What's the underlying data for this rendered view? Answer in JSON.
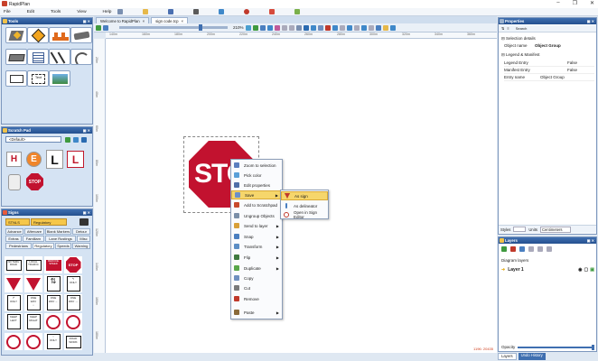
{
  "window": {
    "title": "RapidPlan",
    "minimize": "–",
    "restore": "❐",
    "close": "✕"
  },
  "menu": [
    "File",
    "Edit",
    "Tools",
    "View",
    "Help"
  ],
  "tools_panel": {
    "title": "Tools"
  },
  "scratchpad": {
    "title": "Scratch Pad",
    "selector": "<Default>"
  },
  "signs_panel": {
    "title": "Signs",
    "dropdown_left": "STNLS",
    "dropdown_right": "Regulatory",
    "categories_row1": [
      "Advance",
      "Aftercare",
      "Blank Markers",
      "Detour"
    ],
    "categories_row2": [
      "Extras",
      "Familiarn",
      "Lane Rustings",
      "Misc"
    ],
    "categories_row3": [
      "Pedestrians",
      "Regulatory",
      "Speeds",
      "Warning"
    ]
  },
  "tabs": [
    {
      "label": "Welcome to RapidPlan",
      "close": "×",
      "active": false
    },
    {
      "label": "sign code.tcp",
      "close": "×",
      "active": true
    }
  ],
  "zoom": "210%",
  "ruler_top": [
    "140m",
    "160m",
    "180m",
    "200m",
    "220m",
    "240m",
    "260m",
    "280m",
    "300m",
    "320m",
    "340m",
    "360m"
  ],
  "ruler_left": [
    "20m",
    "40m",
    "60m",
    "80m",
    "100m",
    "120m",
    "140m",
    "160m",
    "180m"
  ],
  "stop_sign_text": "STO",
  "context_menu": [
    {
      "label": "Zoom to selection",
      "arrow": "",
      "highlighted": false,
      "color": "#5b7fbf"
    },
    {
      "label": "Pick color",
      "arrow": "",
      "highlighted": false,
      "color": "#5aa0d8"
    },
    {
      "label": "Edit properties",
      "arrow": "",
      "highlighted": false,
      "color": "#4f6fa8"
    },
    {
      "label": "Save",
      "arrow": "▶",
      "highlighted": true,
      "color": "#6b8fc9"
    },
    {
      "label": "Add to Scratchpad",
      "arrow": "",
      "highlighted": false,
      "color": "#c94a2b"
    },
    {
      "label": "Ungroup Objects",
      "arrow": "",
      "highlighted": false,
      "color": "#7b8fa8"
    },
    {
      "label": "Send to layer",
      "arrow": "▶",
      "highlighted": false,
      "color": "#d8a038"
    },
    {
      "label": "Snap",
      "arrow": "▶",
      "highlighted": false,
      "color": "#4a7fc0"
    },
    {
      "label": "Transform",
      "arrow": "▶",
      "highlighted": false,
      "color": "#5c8ec5"
    },
    {
      "label": "Flip",
      "arrow": "▶",
      "highlighted": false,
      "color": "#3f7a3f"
    },
    {
      "label": "Duplicate",
      "arrow": "▶",
      "highlighted": false,
      "color": "#59a64a"
    },
    {
      "label": "Copy",
      "arrow": "",
      "highlighted": false,
      "color": "#6f8fbf"
    },
    {
      "label": "Cut",
      "arrow": "",
      "highlighted": false,
      "color": "#7a7a7a"
    },
    {
      "label": "Remove",
      "arrow": "",
      "highlighted": false,
      "color": "#c0392b"
    },
    {
      "label": "Paste",
      "arrow": "▶",
      "highlighted": false,
      "color": "#8a6a3a"
    }
  ],
  "submenu": [
    {
      "label": "As sign",
      "highlighted": true
    },
    {
      "label": "As delineator",
      "highlighted": false
    },
    {
      "label": "Open in Sign Editor",
      "highlighted": false
    }
  ],
  "properties": {
    "title": "Properties",
    "search": "Search",
    "section1": "Selection details",
    "object_name_label": "Object name",
    "object_name_value": "Object Group",
    "section2": "Legend & Manifest",
    "rows": [
      {
        "label": "Legend Entry",
        "value": "False"
      },
      {
        "label": "Manifest Entry",
        "value": "False"
      },
      {
        "label": "Entry name",
        "value": "Object Group"
      }
    ],
    "styles_label": "Styles",
    "units_label": "Units",
    "units_value": "Centimeters"
  },
  "layers": {
    "title": "Layers",
    "diagram_layers": "Diagram layers",
    "layer1": "Layer 1",
    "opacity": "Opacity"
  },
  "status": {
    "coords": "1196: 20435"
  },
  "bottom_tabs": [
    "Layers",
    "Undo History"
  ],
  "colors": {
    "accent": "#24508f",
    "stop_red": "#c2122f",
    "highlight": "#f6d66b"
  }
}
